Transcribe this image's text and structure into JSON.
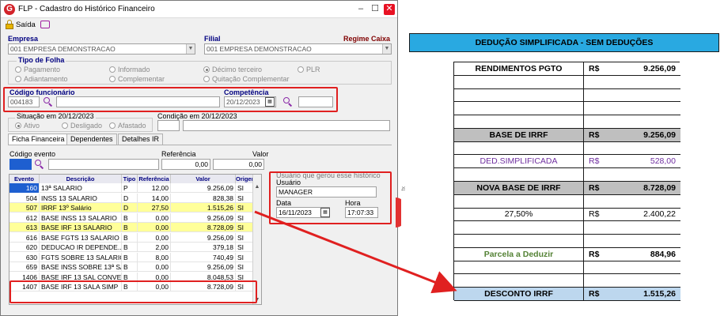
{
  "window": {
    "title": "FLP - Cadastro do Histórico Financeiro",
    "app_icon_letter": "G",
    "exit_label": "Saída"
  },
  "empresa": {
    "label": "Empresa",
    "value": "001 EMPRESA DEMONSTRACAO"
  },
  "filial": {
    "label": "Filial",
    "value": "001 EMPRESA DEMONSTRACAO",
    "regime_label": "Regime Caixa"
  },
  "tipo_folha": {
    "label": "Tipo de Folha",
    "options": [
      "Pagamento",
      "Informado",
      "Décimo terceiro",
      "PLR",
      "Adiantamento",
      "Complementar",
      "Quitação Complementar"
    ],
    "selected": "Décimo terceiro"
  },
  "codigo_funcionario": {
    "label": "Código funcionário",
    "value": "004183"
  },
  "competencia": {
    "label": "Competência",
    "value": "20/12/2023"
  },
  "situacao": {
    "label": "Situação em 20/12/2023",
    "options": [
      "Ativo",
      "Desligado",
      "Afastado"
    ],
    "selected": "Ativo",
    "condicao_label": "Condição em 20/12/2023"
  },
  "tabs": [
    "Ficha Financeira",
    "Dependentes",
    "Detalhes IR"
  ],
  "evento_filter": {
    "codigo_label": "Código evento",
    "referencia_label": "Referência",
    "referencia_value": "0,00",
    "valor_label": "Valor",
    "valor_value": "0,00"
  },
  "grid": {
    "columns": [
      "Evento",
      "Descrição",
      "Tipo",
      "Referência",
      "Valor",
      "Origem"
    ],
    "rows": [
      {
        "evento": "160",
        "descricao": "13ª SALARIO",
        "tipo": "P",
        "referencia": "12,00",
        "valor": "9.256,09",
        "origem": "SI",
        "highlight": "selected"
      },
      {
        "evento": "504",
        "descricao": "INSS 13 SALARIO",
        "tipo": "D",
        "referencia": "14,00",
        "valor": "828,38",
        "origem": "SI",
        "highlight": "none"
      },
      {
        "evento": "507",
        "descricao": "IRRF 13º Salário",
        "tipo": "D",
        "referencia": "27,50",
        "valor": "1.515,26",
        "origem": "SI",
        "highlight": "yellow"
      },
      {
        "evento": "612",
        "descricao": "BASE INSS 13 SALARIO",
        "tipo": "B",
        "referencia": "0,00",
        "valor": "9.256,09",
        "origem": "SI",
        "highlight": "none"
      },
      {
        "evento": "613",
        "descricao": "BASE IRF 13 SALARIO",
        "tipo": "B",
        "referencia": "0,00",
        "valor": "8.728,09",
        "origem": "SI",
        "highlight": "yellow"
      },
      {
        "evento": "616",
        "descricao": "BASE FGTS 13 SALARIO",
        "tipo": "B",
        "referencia": "0,00",
        "valor": "9.256,09",
        "origem": "SI",
        "highlight": "none"
      },
      {
        "evento": "620",
        "descricao": "DEDUCAO IR DEPENDE...",
        "tipo": "B",
        "referencia": "2,00",
        "valor": "379,18",
        "origem": "SI",
        "highlight": "none"
      },
      {
        "evento": "630",
        "descricao": "FGTS SOBRE 13 SALARIO",
        "tipo": "B",
        "referencia": "8,00",
        "valor": "740,49",
        "origem": "SI",
        "highlight": "none"
      },
      {
        "evento": "659",
        "descricao": "BASE INSS SOBRE 13ª SA",
        "tipo": "B",
        "referencia": "0,00",
        "valor": "9.256,09",
        "origem": "SI",
        "highlight": "none"
      },
      {
        "evento": "1406",
        "descricao": "BASE IRF 13 SAL CONVE",
        "tipo": "B",
        "referencia": "0,00",
        "valor": "8.048,53",
        "origem": "SI",
        "highlight": "none"
      },
      {
        "evento": "1407",
        "descricao": "BASE IRF 13 SALA SIMP",
        "tipo": "B",
        "referencia": "0,00",
        "valor": "8.728,09",
        "origem": "SI",
        "highlight": "none"
      }
    ]
  },
  "audit": {
    "header": "Usuário que gerou esse histórico",
    "usuario_label": "Usuário",
    "usuario_value": "MANAGER",
    "data_label": "Data",
    "data_value": "16/11/2023",
    "hora_label": "Hora",
    "hora_value": "17:07:33"
  },
  "sheet": {
    "title": "DEDUÇÃO SIMPLIFICADA - SEM DEDUÇÕES",
    "rows": [
      {
        "label": "RENDIMENTOS PGTO",
        "currency": "R$",
        "value": "9.256,09",
        "style": "bold"
      },
      {
        "label": "",
        "currency": "",
        "value": "",
        "style": "plain"
      },
      {
        "label": "",
        "currency": "",
        "value": "",
        "style": "plain"
      },
      {
        "label": "",
        "currency": "",
        "value": "",
        "style": "plain"
      },
      {
        "label": "",
        "currency": "",
        "value": "",
        "style": "plain"
      },
      {
        "label": "BASE DE IRRF",
        "currency": "R$",
        "value": "9.256,09",
        "style": "gray"
      },
      {
        "label": "",
        "currency": "",
        "value": "",
        "style": "plain"
      },
      {
        "label": "DED.SIMPLIFICADA",
        "currency": "R$",
        "value": "528,00",
        "style": "purple"
      },
      {
        "label": "",
        "currency": "",
        "value": "",
        "style": "plain"
      },
      {
        "label": "NOVA BASE DE IRRF",
        "currency": "R$",
        "value": "8.728,09",
        "style": "gray"
      },
      {
        "label": "",
        "currency": "",
        "value": "",
        "style": "plain"
      },
      {
        "label": "27,50%",
        "currency": "R$",
        "value": "2.400,22",
        "style": "plain"
      },
      {
        "label": "",
        "currency": "",
        "value": "",
        "style": "plain"
      },
      {
        "label": "",
        "currency": "",
        "value": "",
        "style": "plain"
      },
      {
        "label": "Parcela a Deduzir",
        "currency": "R$",
        "value": "884,96",
        "style": "green"
      },
      {
        "label": "",
        "currency": "",
        "value": "",
        "style": "plain"
      },
      {
        "label": "",
        "currency": "",
        "value": "",
        "style": "plain"
      },
      {
        "label": "DESCONTO IRRF",
        "currency": "R$",
        "value": "1.515,26",
        "style": "blue"
      }
    ]
  },
  "colors": {
    "highlight_yellow": "#ffff99",
    "selected_blue": "#1e5fd0",
    "annotation_red": "#e02020",
    "title_blue": "#29a9e1",
    "gray_row": "#bfbfbf",
    "blue_row": "#bdd7ee",
    "purple": "#7030a0",
    "green": "#548235"
  }
}
